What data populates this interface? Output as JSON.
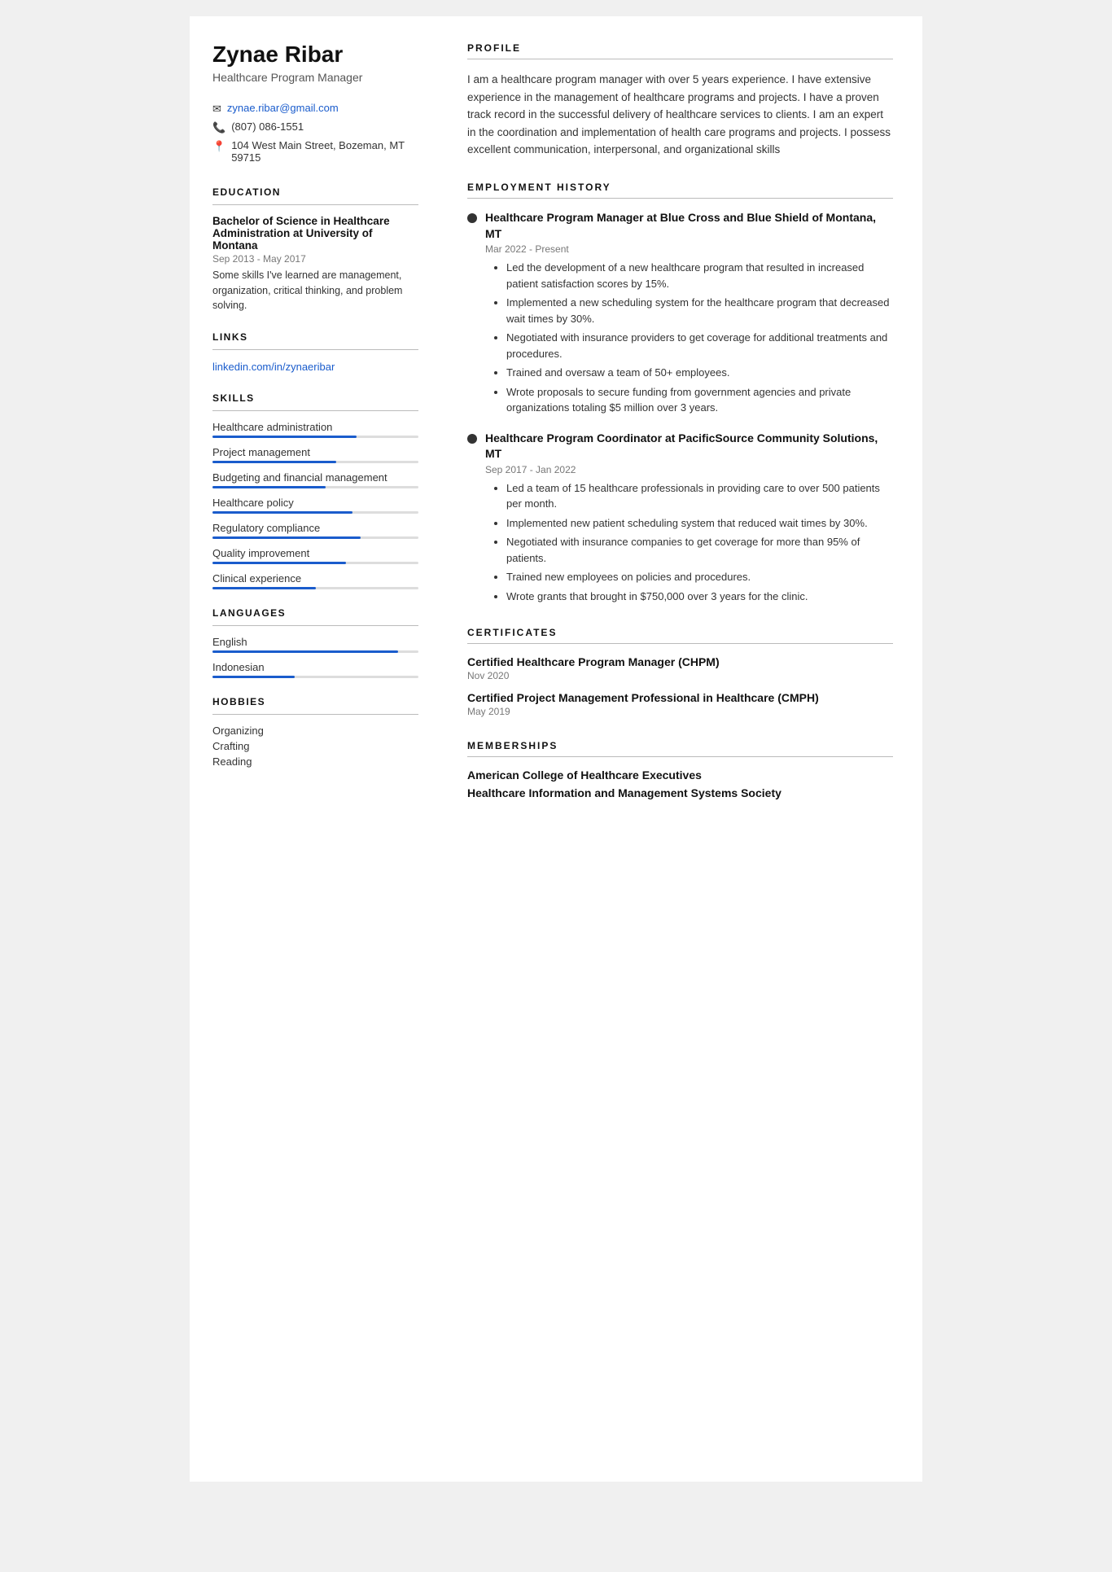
{
  "sidebar": {
    "name": "Zynae Ribar",
    "title": "Healthcare Program Manager",
    "contact": {
      "email": "zynae.ribar@gmail.com",
      "phone": "(807) 086-1551",
      "address": "104 West Main Street, Bozeman, MT 59715"
    },
    "education": {
      "heading": "EDUCATION",
      "degree": "Bachelor of Science in Healthcare Administration at University of Montana",
      "date": "Sep 2013 - May 2017",
      "description": "Some skills I've learned are management, organization, critical thinking, and problem solving."
    },
    "links": {
      "heading": "LINKS",
      "url": "linkedin.com/in/zynaeribar",
      "href": "https://linkedin.com/in/zynaeribar"
    },
    "skills": {
      "heading": "SKILLS",
      "items": [
        {
          "label": "Healthcare administration",
          "percent": 70
        },
        {
          "label": "Project management",
          "percent": 60
        },
        {
          "label": "Budgeting and financial management",
          "percent": 55
        },
        {
          "label": "Healthcare policy",
          "percent": 68
        },
        {
          "label": "Regulatory compliance",
          "percent": 72
        },
        {
          "label": "Quality improvement",
          "percent": 65
        },
        {
          "label": "Clinical experience",
          "percent": 50
        }
      ]
    },
    "languages": {
      "heading": "LANGUAGES",
      "items": [
        {
          "label": "English",
          "percent": 90
        },
        {
          "label": "Indonesian",
          "percent": 40
        }
      ]
    },
    "hobbies": {
      "heading": "HOBBIES",
      "items": [
        "Organizing",
        "Crafting",
        "Reading"
      ]
    }
  },
  "main": {
    "profile": {
      "heading": "PROFILE",
      "text": "I am a healthcare program manager with over 5 years experience. I have extensive experience in the management of healthcare programs and projects. I have a proven track record in the successful delivery of healthcare services to clients. I am an expert in the coordination and implementation of health care programs and projects. I possess excellent communication, interpersonal, and organizational skills"
    },
    "employment": {
      "heading": "EMPLOYMENT HISTORY",
      "jobs": [
        {
          "title": "Healthcare Program Manager at Blue Cross and Blue Shield of Montana, MT",
          "date": "Mar 2022 - Present",
          "bullets": [
            "Led the development of a new healthcare program that resulted in increased patient satisfaction scores by 15%.",
            "Implemented a new scheduling system for the healthcare program that decreased wait times by 30%.",
            "Negotiated with insurance providers to get coverage for additional treatments and procedures.",
            "Trained and oversaw a team of 50+ employees.",
            "Wrote proposals to secure funding from government agencies and private organizations totaling $5 million over 3 years."
          ]
        },
        {
          "title": "Healthcare Program Coordinator at PacificSource Community Solutions, MT",
          "date": "Sep 2017 - Jan 2022",
          "bullets": [
            "Led a team of 15 healthcare professionals in providing care to over 500 patients per month.",
            "Implemented new patient scheduling system that reduced wait times by 30%.",
            "Negotiated with insurance companies to get coverage for more than 95% of patients.",
            "Trained new employees on policies and procedures.",
            "Wrote grants that brought in $750,000 over 3 years for the clinic."
          ]
        }
      ]
    },
    "certificates": {
      "heading": "CERTIFICATES",
      "items": [
        {
          "name": "Certified Healthcare Program Manager (CHPM)",
          "date": "Nov 2020"
        },
        {
          "name": "Certified Project Management Professional in Healthcare (CMPH)",
          "date": "May 2019"
        }
      ]
    },
    "memberships": {
      "heading": "MEMBERSHIPS",
      "items": [
        "American College of Healthcare Executives",
        "Healthcare Information and Management Systems Society"
      ]
    }
  }
}
